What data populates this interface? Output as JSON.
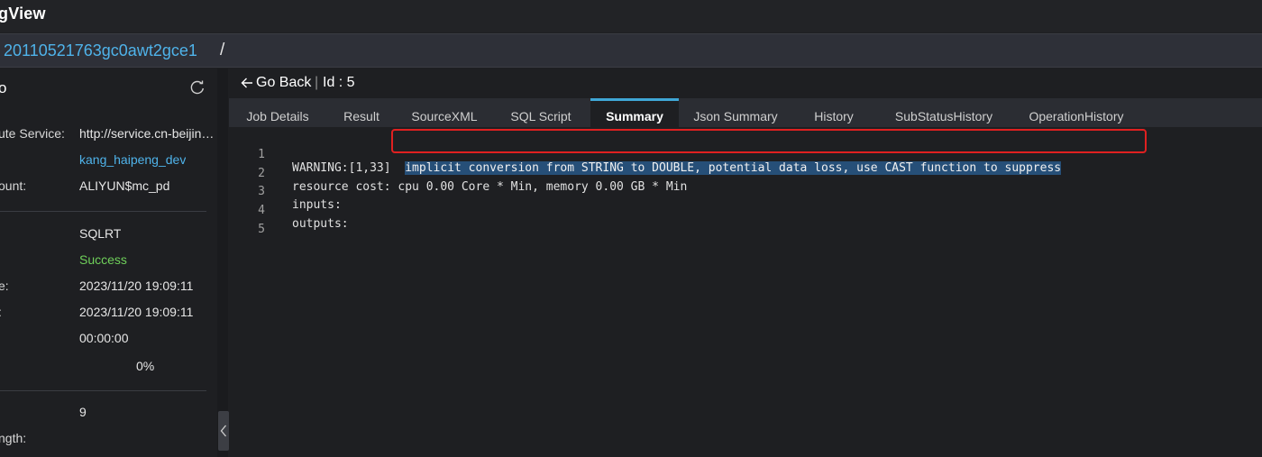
{
  "app": {
    "title": "gView"
  },
  "path": {
    "job_id": "20110521763gc0awt2gce1",
    "separator": "/"
  },
  "left_panel": {
    "header": "o",
    "rows": [
      {
        "key": "ute Service:",
        "value": "http://service.cn-beijing.maxcompute.aliyun.com"
      },
      {
        "key": "",
        "value": "kang_haipeng_dev"
      },
      {
        "key": "ount:",
        "value": "ALIYUN$mc_pd"
      },
      {
        "key": "",
        "value": "SQLRT"
      },
      {
        "key": "",
        "value": "Success"
      },
      {
        "key": "e:",
        "value": "2023/11/20 19:09:11"
      },
      {
        "key": ":",
        "value": "2023/11/20 19:09:11"
      },
      {
        "key": "",
        "value": "00:00:00"
      },
      {
        "key": "",
        "value": "0%"
      },
      {
        "key": "",
        "value": "9"
      },
      {
        "key": "ngth:",
        "value": ""
      }
    ]
  },
  "toolbar": {
    "go_back": "Go Back",
    "separator": "|",
    "id_label": "Id : 5"
  },
  "tabs": [
    {
      "label": "Job Details"
    },
    {
      "label": "Result"
    },
    {
      "label": "SourceXML"
    },
    {
      "label": "SQL Script"
    },
    {
      "label": "Summary"
    },
    {
      "label": "Json Summary"
    },
    {
      "label": "History"
    },
    {
      "label": "SubStatusHistory"
    },
    {
      "label": "OperationHistory"
    }
  ],
  "editor": {
    "lines": [
      {
        "num": "1",
        "pre": "WARNING:[1,33]  ",
        "selected": "implicit conversion from STRING to DOUBLE, potential data loss, use CAST function to suppress"
      },
      {
        "num": "2",
        "pre": "resource cost: cpu 0.00 Core * Min, memory 0.00 GB * Min",
        "selected": ""
      },
      {
        "num": "3",
        "pre": "inputs:",
        "selected": ""
      },
      {
        "num": "4",
        "pre": "outputs:",
        "selected": ""
      },
      {
        "num": "5",
        "pre": "",
        "selected": ""
      }
    ]
  },
  "colors": {
    "accent": "#3fa7d6",
    "link": "#4fb3ea",
    "success": "#6fcf5a",
    "highlight_box": "#e02020"
  },
  "icons": {
    "refresh": "refresh-icon",
    "back": "arrow-left-icon",
    "collapse": "chevron-left-icon"
  }
}
